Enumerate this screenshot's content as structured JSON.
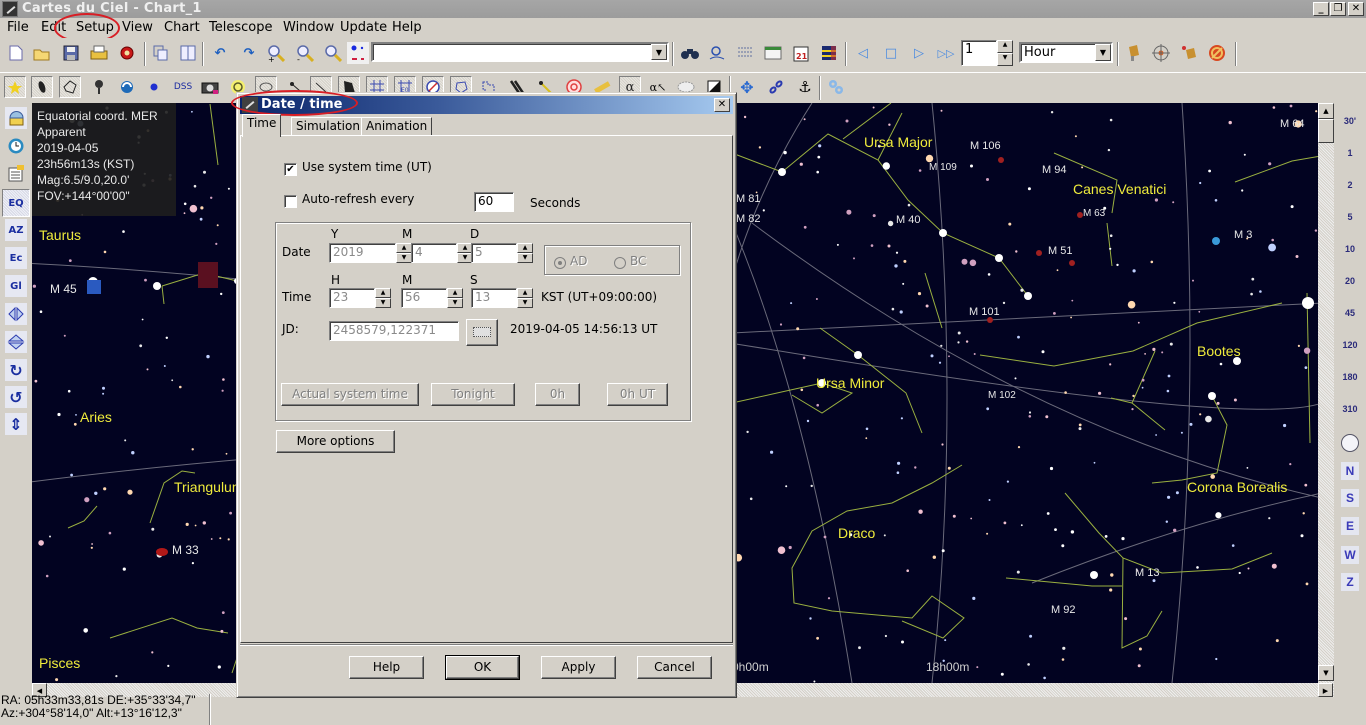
{
  "window": {
    "title": "Cartes du Ciel - Chart_1",
    "controls": {
      "minimize": "_",
      "restore": "❐",
      "close": "✕"
    }
  },
  "menubar": {
    "items": [
      "File",
      "Edit",
      "Setup",
      "View",
      "Chart",
      "Telescope",
      "Window",
      "Update",
      "Help"
    ],
    "highlighted": "Setup"
  },
  "toolbar_main": {
    "icons": [
      "new-chart-icon",
      "open-icon",
      "save-icon",
      "print-icon",
      "config-icon",
      "copy-chart-icon",
      "tile-icon",
      "undo-icon",
      "redo-icon",
      "zoom-in-icon",
      "zoom-out-icon",
      "zoom-icon",
      "star-colors-icon"
    ],
    "search_value": "",
    "search_icons": [
      "binoculars-icon",
      "find-icon",
      "list-icon",
      "calendar-window-icon",
      "calendar-21-icon",
      "chart-color-icon"
    ],
    "animation_icons": [
      "step-back-icon",
      "stop-icon",
      "step-forward-icon",
      "fast-forward-icon"
    ],
    "step_value": "1",
    "step_unit": "Hour",
    "telescope_icons": [
      "telescope-icon",
      "crosshair-icon",
      "telescope-sync-icon",
      "telescope-stop-icon"
    ]
  },
  "toolbar_objects": {
    "icons": [
      "stars-icon",
      "nebulae-icon",
      "lines-icon",
      "milky-way-icon",
      "planets-icon",
      "asteroids-icon",
      "dss-icon",
      "camera-icon",
      "sun-icon",
      "comets-icon",
      "variable-icon",
      "double-icon",
      "dark-nebulae-icon",
      "grid-icon",
      "eq-grid-icon",
      "compass-icon",
      "constellation-boundaries-icon",
      "constellation-lines-icon",
      "milky-way-band-icon",
      "ecliptic-icon",
      "horizon-icon",
      "measure-icon",
      "labels-icon",
      "label-edit-icon",
      "mask-icon",
      "night-vision-icon",
      "move-icon",
      "link-icon",
      "anchor-icon",
      "settings-icon"
    ],
    "dss_label": "DSS",
    "alpha_label": "α"
  },
  "left_toolbar": {
    "buttons": [
      {
        "name": "location-icon",
        "label": ""
      },
      {
        "name": "clock-icon",
        "label": ""
      },
      {
        "name": "object-list-icon",
        "label": ""
      },
      {
        "name": "eq-projection-button",
        "label": "EQ"
      },
      {
        "name": "az-projection-button",
        "label": "AZ"
      },
      {
        "name": "ecliptic-projection-button",
        "label": "Ec"
      },
      {
        "name": "galactic-projection-button",
        "label": "Gl"
      },
      {
        "name": "flip-horizontal-icon",
        "label": "◁▷"
      },
      {
        "name": "flip-vertical-icon",
        "label": "⬘"
      },
      {
        "name": "rotate-right-icon",
        "label": "↻"
      },
      {
        "name": "rotate-left-icon",
        "label": "↺"
      },
      {
        "name": "vertical-icon",
        "label": "⇕"
      }
    ]
  },
  "info_overlay": {
    "lines": [
      "Equatorial coord. MER",
      "Apparent",
      "2019-04-05",
      "23h56m13s (KST)",
      "Mag:6.5/9.0,20.0'",
      "FOV:+144°00'00\""
    ]
  },
  "sky_chart": {
    "constellations": [
      "Taurus",
      "Aries",
      "Triangulum",
      "Pisces",
      "Ursa Major",
      "Canes Venatici",
      "Bootes",
      "Ursa Minor",
      "Draco",
      "Corona Borealis"
    ],
    "objects": [
      "M 45",
      "M 33",
      "M 81",
      "M 82",
      "M 109",
      "M 106",
      "M 94",
      "M 63",
      "M 40",
      "M 51",
      "M 101",
      "M 102",
      "M 3",
      "M 64",
      "M 13",
      "M 92"
    ],
    "grid_labels": [
      "0h00m",
      "18h00m"
    ]
  },
  "right_bar": {
    "zoom_levels": [
      "30'",
      "1",
      "2",
      "5",
      "10",
      "20",
      "45",
      "120",
      "180",
      "310"
    ],
    "directions": [
      "N",
      "S",
      "E",
      "W",
      "Z"
    ]
  },
  "status": {
    "line1": "RA: 05h33m33,81s DE:+35°33'34,7\"",
    "line2": "Az:+304°58'14,0\" Alt:+13°16'12,3\""
  },
  "dialog": {
    "title": "Date / time",
    "close": "✕",
    "tabs": [
      "Time",
      "Simulation",
      "Animation"
    ],
    "active_tab": "Time",
    "use_system_time": {
      "label": "Use system time (UT)",
      "checked": true
    },
    "auto_refresh": {
      "label": "Auto-refresh every",
      "checked": false,
      "value": "60",
      "unit": "Seconds"
    },
    "date": {
      "label": "Date",
      "headers": [
        "Y",
        "M",
        "D"
      ],
      "year": "2019",
      "month": "4",
      "day": "5",
      "era": {
        "ad": "AD",
        "bc": "BC",
        "selected": "AD"
      }
    },
    "time": {
      "label": "Time",
      "headers": [
        "H",
        "M",
        "S"
      ],
      "hour": "23",
      "minute": "56",
      "second": "13",
      "zone": "KST (UT+09:00:00)"
    },
    "jd": {
      "label": "JD:",
      "value": "2458579,122371",
      "ut_text": "2019-04-05 14:56:13 UT"
    },
    "quick_buttons": [
      "Actual system time",
      "Tonight",
      "0h",
      "0h UT"
    ],
    "more_options": "More options",
    "footer": {
      "help": "Help",
      "ok": "OK",
      "apply": "Apply",
      "cancel": "Cancel"
    }
  }
}
